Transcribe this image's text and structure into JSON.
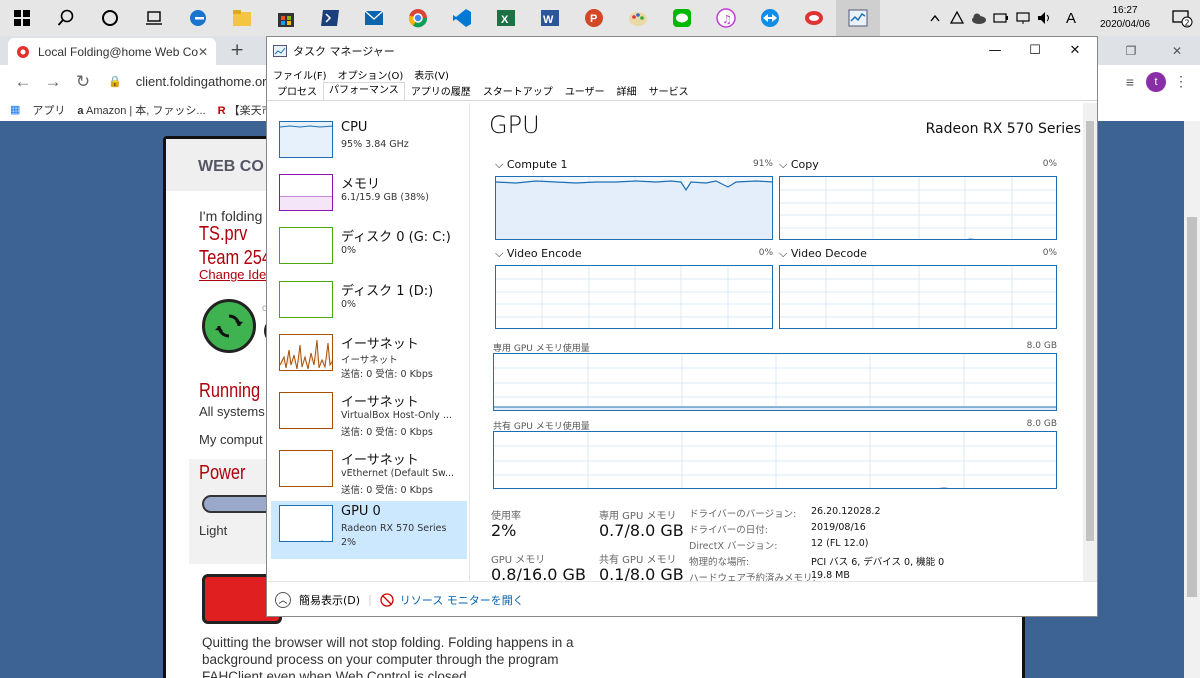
{
  "taskbar": {
    "apps": [
      "start",
      "search",
      "cortana",
      "task-view",
      "edge",
      "file-explorer",
      "store",
      "powershell",
      "mail",
      "chrome",
      "vscode",
      "excel",
      "word",
      "powerpoint",
      "paint",
      "line",
      "itunes",
      "teamviewer",
      "app",
      "task-manager"
    ],
    "tray": {
      "ime": "A",
      "time": "16:27",
      "date": "2020/04/06",
      "notifications": "2"
    }
  },
  "browser": {
    "tab_title": "Local Folding@home Web Contr",
    "url": "client.foldingathome.org",
    "bookmarks": [
      "アプリ",
      "Amazon | 本, ファッシ...",
      "【楽天市"
    ],
    "avatar_letter": "t"
  },
  "page": {
    "header": "WEB CO",
    "folding_as": "I'm folding",
    "user": "TS.prv",
    "team": "Team 254",
    "change_identity": "Change Ide",
    "status_letter": "c",
    "status": "Running",
    "status_sub": "All systems",
    "my_computer": "My comput",
    "power_title": "Power",
    "power_level": "Light",
    "quit_note": "Quitting the browser will not stop folding. Folding happens in a background process on your computer through the program FAHClient even when Web Control is closed."
  },
  "taskmgr": {
    "title": "タスク マネージャー",
    "menu": [
      "ファイル(F)",
      "オプション(O)",
      "表示(V)"
    ],
    "tabs": [
      "プロセス",
      "パフォーマンス",
      "アプリの履歴",
      "スタートアップ",
      "ユーザー",
      "詳細",
      "サービス"
    ],
    "active_tab": "パフォーマンス",
    "items": [
      {
        "name": "CPU",
        "line1": "95%  3.84 GHz",
        "line2": ""
      },
      {
        "name": "メモリ",
        "line1": "6.1/15.9 GB (38%)",
        "line2": ""
      },
      {
        "name": "ディスク 0 (G: C:)",
        "line1": "0%",
        "line2": ""
      },
      {
        "name": "ディスク 1 (D:)",
        "line1": "0%",
        "line2": ""
      },
      {
        "name": "イーサネット",
        "line1": "イーサネット",
        "line2": "送信: 0  受信: 0 Kbps"
      },
      {
        "name": "イーサネット",
        "line1": "VirtualBox Host-Only ...",
        "line2": "送信: 0  受信: 0 Kbps"
      },
      {
        "name": "イーサネット",
        "line1": "vEthernet (Default Sw...",
        "line2": "送信: 0  受信: 0 Kbps"
      },
      {
        "name": "GPU 0",
        "line1": "Radeon RX 570 Series",
        "line2": "2%"
      }
    ],
    "gpu": {
      "title": "GPU",
      "model": "Radeon RX 570 Series",
      "engines": [
        {
          "name": "Compute 1",
          "pct": "91%"
        },
        {
          "name": "Copy",
          "pct": "0%"
        },
        {
          "name": "Video Encode",
          "pct": "0%"
        },
        {
          "name": "Video Decode",
          "pct": "0%"
        }
      ],
      "dedicated_label": "専用 GPU メモリ使用量",
      "dedicated_max": "8.0 GB",
      "shared_label": "共有 GPU メモリ使用量",
      "shared_max": "8.0 GB",
      "stats": [
        {
          "label": "使用率",
          "value": "2%"
        },
        {
          "label": "専用 GPU メモリ",
          "value": "0.7/8.0 GB"
        },
        {
          "label": "GPU メモリ",
          "value": "0.8/16.0 GB"
        },
        {
          "label": "共有 GPU メモリ",
          "value": "0.1/8.0 GB"
        }
      ],
      "info": [
        {
          "k": "ドライバーのバージョン:",
          "v": "26.20.12028.2"
        },
        {
          "k": "ドライバーの日付:",
          "v": "2019/08/16"
        },
        {
          "k": "DirectX バージョン:",
          "v": "12 (FL 12.0)"
        },
        {
          "k": "物理的な場所:",
          "v": "PCI バス 6, デバイス 0, 機能 0"
        },
        {
          "k": "ハードウェア予約済みメモリ:",
          "v": "19.8 MB"
        }
      ]
    },
    "footer": {
      "compact": "簡易表示(D)",
      "resmon": "リソース モニターを開く"
    }
  },
  "colors": {
    "cpu": "#1d6fb5",
    "memory": "#8b12ae",
    "disk": "#4da60c",
    "network": "#a74f01",
    "gpu": "#1d6fb5",
    "selected": "#cce8ff"
  }
}
